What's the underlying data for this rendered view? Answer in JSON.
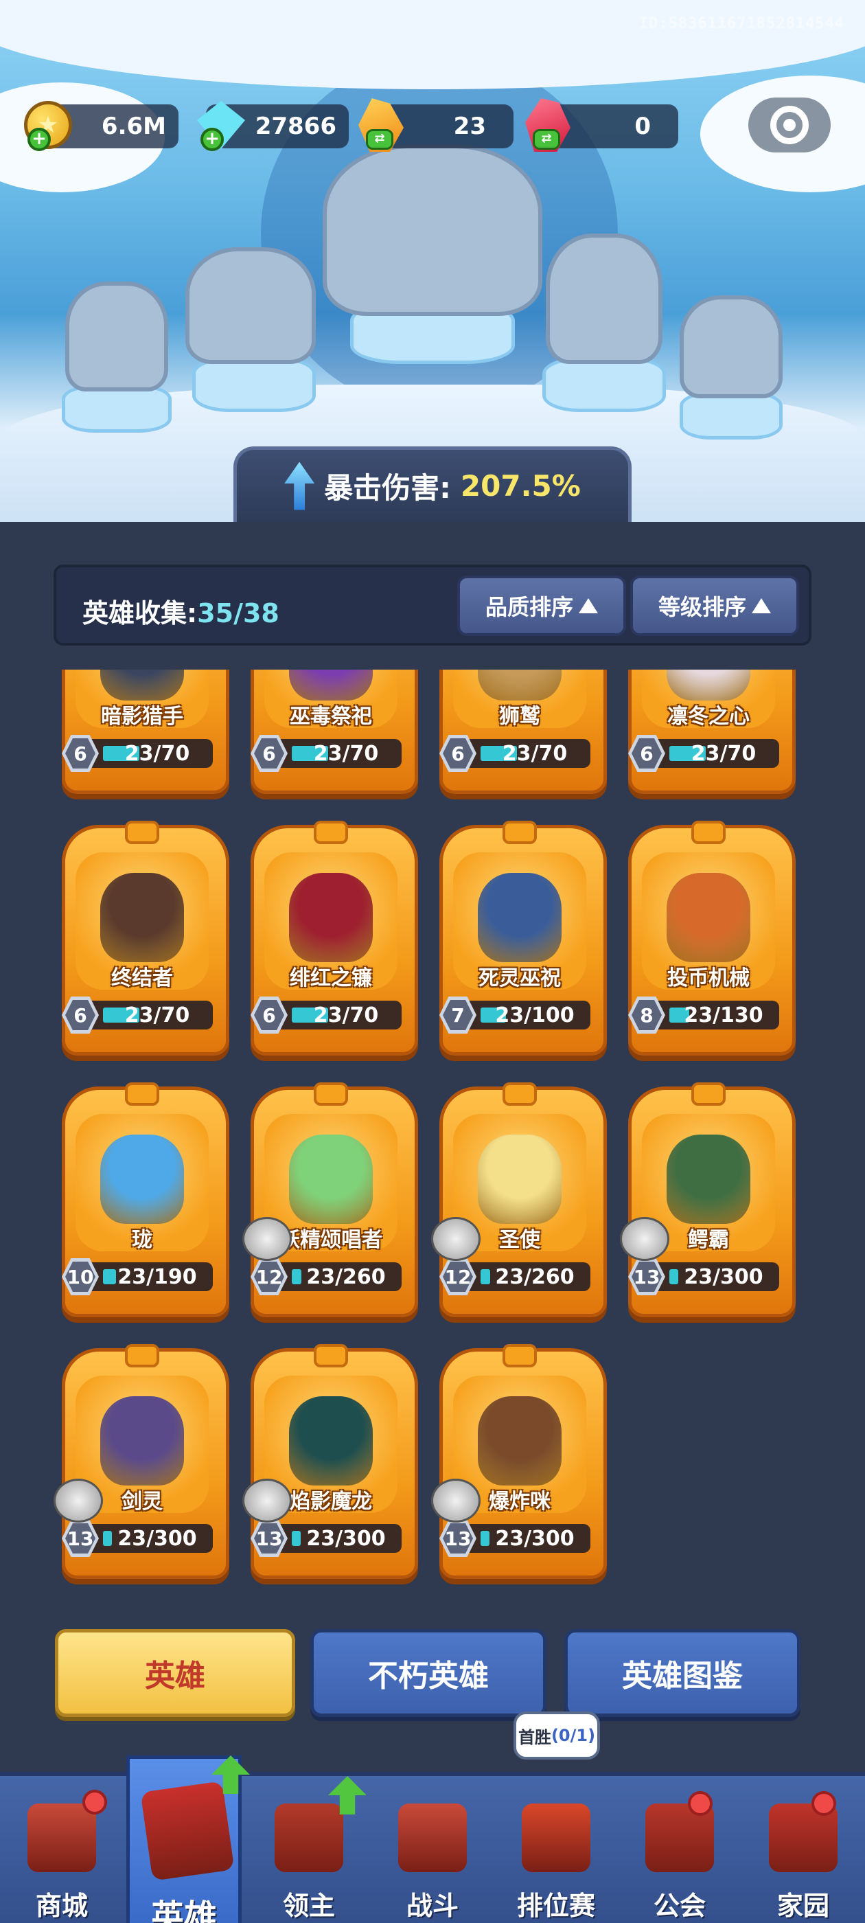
{
  "header": {
    "uid": "ID:5836116718528145​44",
    "resources": [
      {
        "icon": "gold-coin-icon",
        "value": "6.6M",
        "action": "plus-icon"
      },
      {
        "icon": "diamond-icon",
        "value": "27866",
        "action": "plus-icon"
      },
      {
        "icon": "orange-crystal-icon",
        "value": "23",
        "action": "exchange-icon"
      },
      {
        "icon": "red-crystal-icon",
        "value": "0",
        "action": "exchange-icon"
      }
    ],
    "settings_icon": "gear-icon"
  },
  "crit_banner": {
    "label": "暴击伤害:",
    "value": "207.5%"
  },
  "collection": {
    "title": "英雄收集:",
    "count": "35/38",
    "sort_quality": "品质排序",
    "sort_level": "等级排序"
  },
  "heroes": [
    {
      "name": "暗影猎手",
      "star": "6",
      "progress": "23/70",
      "fill": 0.33,
      "color": "#3b4560"
    },
    {
      "name": "巫毒祭祀",
      "star": "6",
      "progress": "23/70",
      "fill": 0.33,
      "color": "#7b3db0"
    },
    {
      "name": "狮鹫",
      "star": "6",
      "progress": "23/70",
      "fill": 0.33,
      "color": "#c79a5a"
    },
    {
      "name": "凛冬之心",
      "star": "6",
      "progress": "23/70",
      "fill": 0.33,
      "color": "#e6d8dc"
    },
    {
      "name": "终结者",
      "star": "6",
      "progress": "23/70",
      "fill": 0.33,
      "color": "#5a3a2c"
    },
    {
      "name": "绯红之镰",
      "star": "6",
      "progress": "23/70",
      "fill": 0.33,
      "color": "#9e1f2f"
    },
    {
      "name": "死灵巫祝",
      "star": "7",
      "progress": "23/100",
      "fill": 0.23,
      "color": "#3a5d9a"
    },
    {
      "name": "投币机械",
      "star": "8",
      "progress": "23/130",
      "fill": 0.18,
      "color": "#d76a2a"
    },
    {
      "name": "珑",
      "star": "10",
      "progress": "23/190",
      "fill": 0.12,
      "color": "#4fa9e8"
    },
    {
      "name": "妖精颂唱者",
      "star": "12",
      "progress": "23/260",
      "fill": 0.09,
      "color": "#7fd27a"
    },
    {
      "name": "圣使",
      "star": "12",
      "progress": "23/260",
      "fill": 0.09,
      "color": "#f4e08a"
    },
    {
      "name": "鳄霸",
      "star": "13",
      "progress": "23/300",
      "fill": 0.08,
      "color": "#3f6e43"
    },
    {
      "name": "剑灵",
      "star": "13",
      "progress": "23/300",
      "fill": 0.08,
      "color": "#5a4a8a"
    },
    {
      "name": "焰影魔龙",
      "star": "13",
      "progress": "23/300",
      "fill": 0.08,
      "color": "#1f4e4e"
    },
    {
      "name": "爆炸咪",
      "star": "13",
      "progress": "23/300",
      "fill": 0.08,
      "color": "#7a4a2a"
    }
  ],
  "tabs": {
    "hero": "英雄",
    "immortal": "不朽英雄",
    "codex": "英雄图鉴"
  },
  "first_win": {
    "label": "首胜",
    "value": "(0/1)"
  },
  "nav": [
    {
      "label": "商城",
      "icon": "shop-icon",
      "color": "#c94a3a"
    },
    {
      "label": "英雄",
      "icon": "hero-card-icon",
      "color": "#c9302c"
    },
    {
      "label": "领主",
      "icon": "lord-scroll-icon",
      "color": "#b23a2a"
    },
    {
      "label": "战斗",
      "icon": "battle-icon",
      "color": "#c94a3a"
    },
    {
      "label": "排位赛",
      "icon": "ranked-knot-icon",
      "color": "#d9472a"
    },
    {
      "label": "公会",
      "icon": "guild-hall-icon",
      "color": "#b8362b"
    },
    {
      "label": "家园",
      "icon": "home-house-icon",
      "color": "#c0342b"
    }
  ]
}
